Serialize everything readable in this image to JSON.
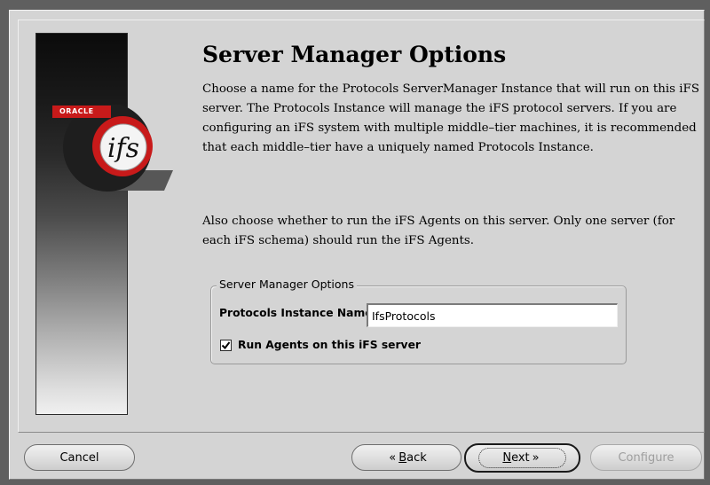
{
  "page": {
    "title": "Server Manager Options",
    "paragraph1": "Choose a name for the Protocols ServerManager Instance that will run on this iFS server. The Protocols Instance will manage the iFS protocol servers. If you are configuring an iFS system with multiple middle–tier machines, it is recommended that each middle–tier have a uniquely named Protocols Instance.",
    "paragraph2": "Also choose whether to run the iFS Agents on this server. Only one server (for each iFS schema) should run the iFS Agents."
  },
  "logo": {
    "brand": "ORACLE",
    "product": "ifs"
  },
  "options_group": {
    "legend": "Server Manager Options",
    "instance_name_label": "Protocols Instance Name:",
    "instance_name_value": "IfsProtocols",
    "run_agents_label": "Run Agents on this iFS server",
    "run_agents_checked": true
  },
  "buttons": {
    "cancel": "Cancel",
    "back_accel": "B",
    "back_rest": "ack",
    "back_icon": "double-chevron-left-icon",
    "next_accel": "N",
    "next_rest": "ext",
    "next_icon": "double-chevron-right-icon",
    "configure": "Configure"
  },
  "colors": {
    "oracle_red": "#c81a1a",
    "logo_red": "#c81a1a",
    "panel_bg": "#d4d4d4"
  }
}
